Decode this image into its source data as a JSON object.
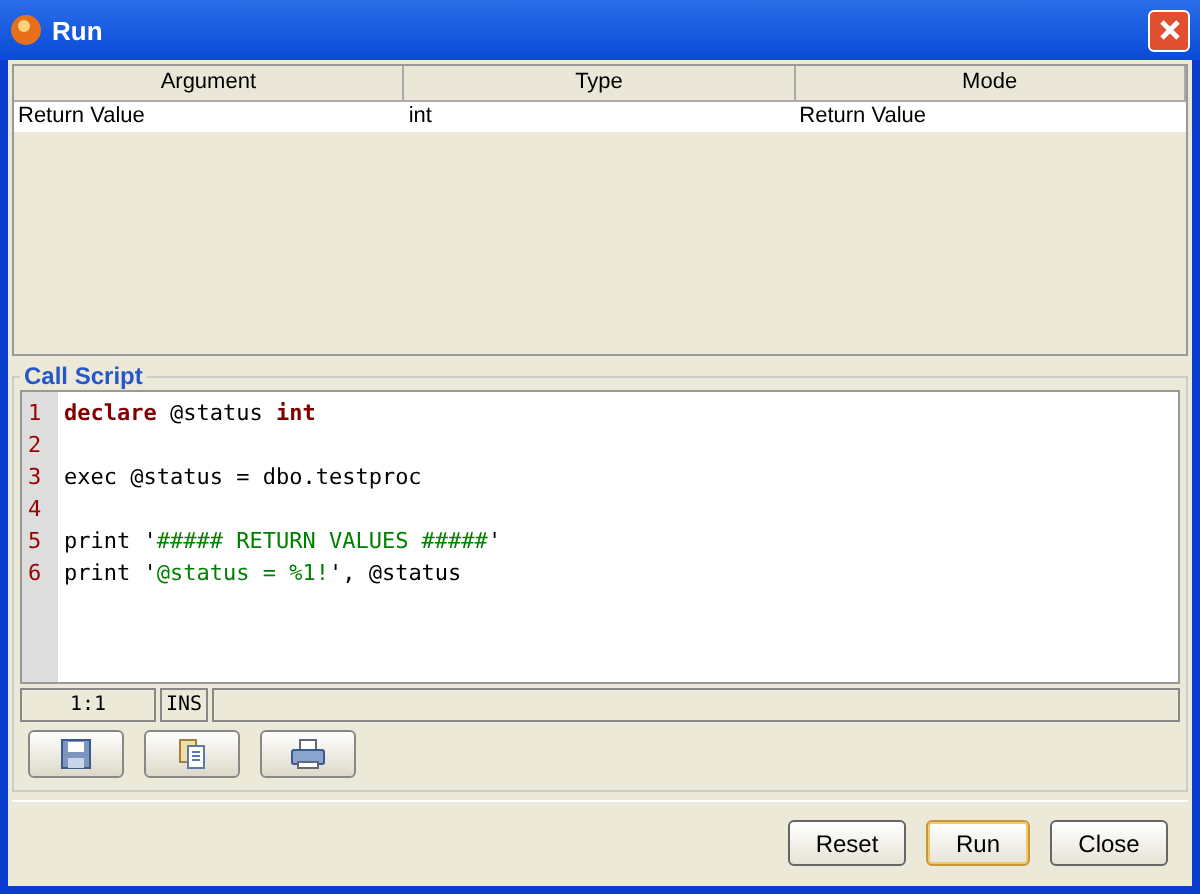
{
  "window": {
    "title": "Run"
  },
  "table": {
    "columns": [
      "Argument",
      "Type",
      "Mode"
    ],
    "rows": [
      [
        "Return Value",
        "int",
        "Return Value"
      ]
    ]
  },
  "script_panel": {
    "title": "Call Script",
    "lines": [
      {
        "number": "1",
        "tokens": [
          {
            "kind": "keyword",
            "text": "declare"
          },
          {
            "kind": "plain",
            "text": " @status "
          },
          {
            "kind": "keyword",
            "text": "int"
          }
        ]
      },
      {
        "number": "2"
      },
      {
        "number": "3",
        "tokens": [
          {
            "kind": "plain",
            "text": "exec @status = dbo.testproc"
          }
        ]
      },
      {
        "number": "4"
      },
      {
        "number": "5",
        "tokens": [
          {
            "kind": "plain",
            "text": "print '"
          },
          {
            "kind": "string",
            "text": "##### RETURN VALUES #####"
          },
          {
            "kind": "plain",
            "text": "'"
          }
        ]
      },
      {
        "number": "6",
        "tokens": [
          {
            "kind": "plain",
            "text": "print '"
          },
          {
            "kind": "string",
            "text": "@status = %1!"
          },
          {
            "kind": "plain",
            "text": "', @status"
          }
        ]
      }
    ],
    "status": {
      "position": "1:1",
      "mode": "INS"
    },
    "tools": [
      {
        "kind": "save"
      },
      {
        "kind": "paste"
      },
      {
        "kind": "print"
      }
    ]
  },
  "buttons": [
    {
      "label": "Reset",
      "focused": false
    },
    {
      "label": "Run",
      "focused": true
    },
    {
      "label": "Close",
      "focused": false
    }
  ]
}
